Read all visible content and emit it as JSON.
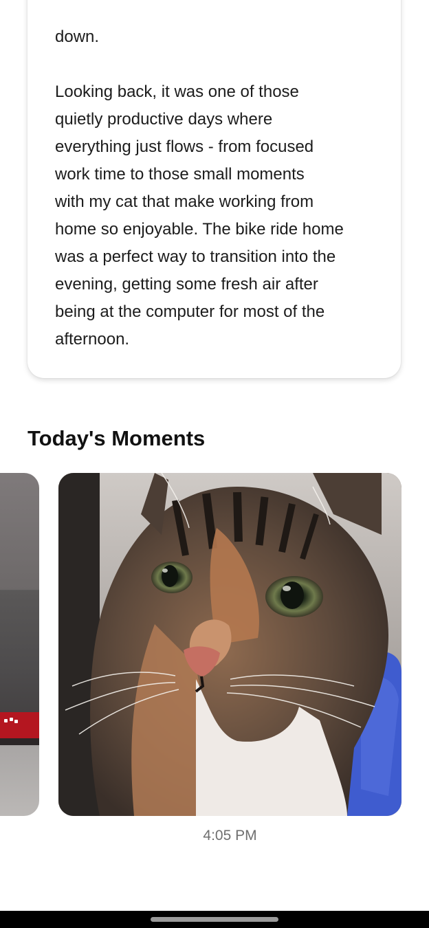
{
  "journal": {
    "tail_line": "down.",
    "paragraph_lines": [
      "Looking back, it was one of those",
      "quietly productive days where",
      "everything just flows - from focused",
      "work time to those small moments",
      "with my cat that make working from",
      "home so enjoyable. The bike ride home",
      "was a perfect way to transition into the",
      "evening, getting some fresh air after",
      "being at the computer for most of the",
      "afternoon."
    ]
  },
  "moments": {
    "title": "Today's Moments",
    "photos": [
      {
        "subject": "desk-photo",
        "caption": ""
      },
      {
        "subject": "cat-photo",
        "caption": "4:05 PM"
      }
    ]
  },
  "colors": {
    "card_shadow": "#d6d6d6",
    "caption_gray": "#6f6f6f",
    "accent_red": "#b41620"
  }
}
